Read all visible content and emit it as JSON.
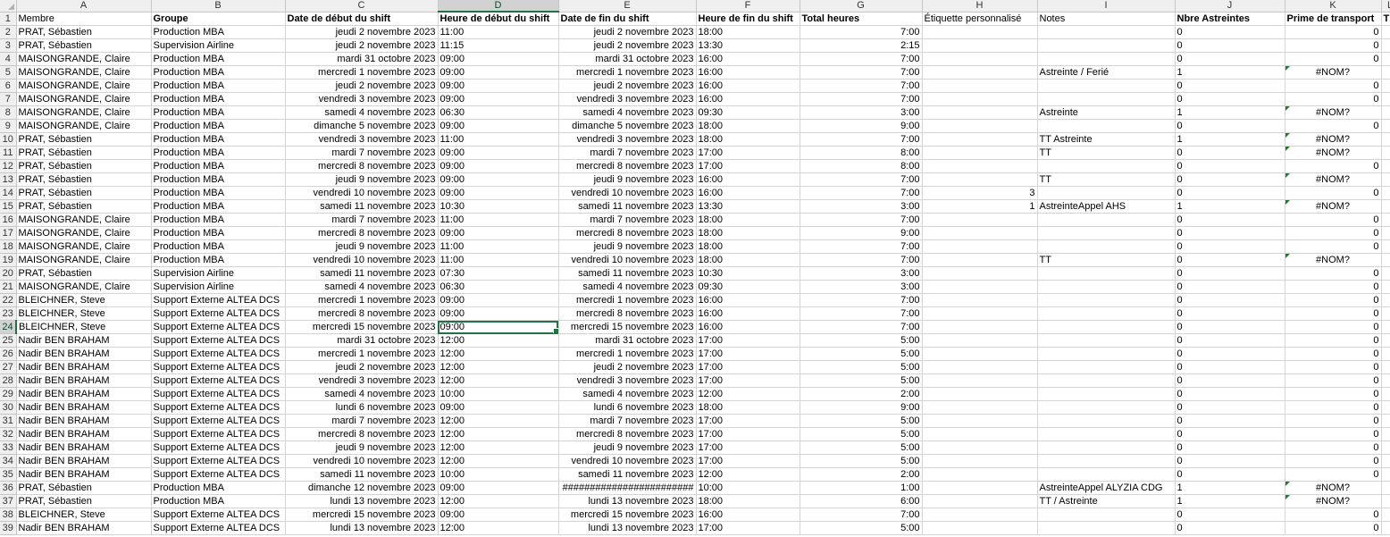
{
  "selected_cell": "D24",
  "columns": [
    "A",
    "B",
    "C",
    "D",
    "E",
    "F",
    "G",
    "H",
    "I",
    "J",
    "K",
    "L"
  ],
  "headers": [
    "Membre",
    "Groupe",
    "Date de début du shift",
    "Heure de début du shift",
    "Date de fin du shift",
    "Heure de fin du shift",
    "Total heures",
    "Étiquette personnalisé",
    "Notes",
    "Nbre Astreintes",
    "Prime de transport",
    "T"
  ],
  "rows": [
    [
      "PRAT, Sébastien",
      "Production MBA",
      "jeudi 2 novembre 2023",
      "11:00",
      "jeudi 2 novembre 2023",
      "18:00",
      "7:00",
      "",
      "",
      "0",
      "0"
    ],
    [
      "PRAT, Sébastien",
      "Supervision Airline",
      "jeudi 2 novembre 2023",
      "11:15",
      "jeudi 2 novembre 2023",
      "13:30",
      "2:15",
      "",
      "",
      "0",
      "0"
    ],
    [
      "MAISONGRANDE, Claire",
      "Production MBA",
      "mardi 31 octobre 2023",
      "09:00",
      "mardi 31 octobre 2023",
      "16:00",
      "7:00",
      "",
      "",
      "0",
      "0"
    ],
    [
      "MAISONGRANDE, Claire",
      "Production MBA",
      "mercredi 1 novembre 2023",
      "09:00",
      "mercredi 1 novembre 2023",
      "16:00",
      "7:00",
      "",
      "Astreinte / Ferié",
      "1",
      "#NOM?"
    ],
    [
      "MAISONGRANDE, Claire",
      "Production MBA",
      "jeudi 2 novembre 2023",
      "09:00",
      "jeudi 2 novembre 2023",
      "16:00",
      "7:00",
      "",
      "",
      "0",
      "0"
    ],
    [
      "MAISONGRANDE, Claire",
      "Production MBA",
      "vendredi 3 novembre 2023",
      "09:00",
      "vendredi 3 novembre 2023",
      "16:00",
      "7:00",
      "",
      "",
      "0",
      "0"
    ],
    [
      "MAISONGRANDE, Claire",
      "Production MBA",
      "samedi 4 novembre 2023",
      "06:30",
      "samedi 4 novembre 2023",
      "09:30",
      "3:00",
      "",
      "Astreinte",
      "1",
      "#NOM?"
    ],
    [
      "MAISONGRANDE, Claire",
      "Production MBA",
      "dimanche 5 novembre 2023",
      "09:00",
      "dimanche 5 novembre 2023",
      "18:00",
      "9:00",
      "",
      "",
      "0",
      "0"
    ],
    [
      "PRAT, Sébastien",
      "Production MBA",
      "vendredi 3 novembre 2023",
      "11:00",
      "vendredi 3 novembre 2023",
      "18:00",
      "7:00",
      "",
      "TT Astreinte",
      "1",
      "#NOM?"
    ],
    [
      "PRAT, Sébastien",
      "Production MBA",
      "mardi 7 novembre 2023",
      "09:00",
      "mardi 7 novembre 2023",
      "17:00",
      "8:00",
      "",
      "TT",
      "0",
      "#NOM?"
    ],
    [
      "PRAT, Sébastien",
      "Production MBA",
      "mercredi 8 novembre 2023",
      "09:00",
      "mercredi 8 novembre 2023",
      "17:00",
      "8:00",
      "",
      "",
      "0",
      "0"
    ],
    [
      "PRAT, Sébastien",
      "Production MBA",
      "jeudi 9 novembre 2023",
      "09:00",
      "jeudi 9 novembre 2023",
      "16:00",
      "7:00",
      "",
      "TT",
      "0",
      "#NOM?"
    ],
    [
      "PRAT, Sébastien",
      "Production MBA",
      "vendredi 10 novembre 2023",
      "09:00",
      "vendredi 10 novembre 2023",
      "16:00",
      "7:00",
      "3",
      "",
      "0",
      "0"
    ],
    [
      "PRAT, Sébastien",
      "Production MBA",
      "samedi 11 novembre 2023",
      "10:30",
      "samedi 11 novembre 2023",
      "13:30",
      "3:00",
      "1",
      "AstreinteAppel AHS",
      "1",
      "#NOM?"
    ],
    [
      "MAISONGRANDE, Claire",
      "Production MBA",
      "mardi 7 novembre 2023",
      "11:00",
      "mardi 7 novembre 2023",
      "18:00",
      "7:00",
      "",
      "",
      "0",
      "0"
    ],
    [
      "MAISONGRANDE, Claire",
      "Production MBA",
      "mercredi 8 novembre 2023",
      "09:00",
      "mercredi 8 novembre 2023",
      "18:00",
      "9:00",
      "",
      "",
      "0",
      "0"
    ],
    [
      "MAISONGRANDE, Claire",
      "Production MBA",
      "jeudi 9 novembre 2023",
      "11:00",
      "jeudi 9 novembre 2023",
      "18:00",
      "7:00",
      "",
      "",
      "0",
      "0"
    ],
    [
      "MAISONGRANDE, Claire",
      "Production MBA",
      "vendredi 10 novembre 2023",
      "11:00",
      "vendredi 10 novembre 2023",
      "18:00",
      "7:00",
      "",
      "TT",
      "0",
      "#NOM?"
    ],
    [
      "PRAT, Sébastien",
      "Supervision Airline",
      "samedi 11 novembre 2023",
      "07:30",
      "samedi 11 novembre 2023",
      "10:30",
      "3:00",
      "",
      "",
      "0",
      "0"
    ],
    [
      "MAISONGRANDE, Claire",
      "Supervision Airline",
      "samedi 4 novembre 2023",
      "06:30",
      "samedi 4 novembre 2023",
      "09:30",
      "3:00",
      "",
      "",
      "0",
      "0"
    ],
    [
      "BLEICHNER, Steve",
      "Support Externe ALTEA DCS",
      "mercredi 1 novembre 2023",
      "09:00",
      "mercredi 1 novembre 2023",
      "16:00",
      "7:00",
      "",
      "",
      "0",
      "0"
    ],
    [
      "BLEICHNER, Steve",
      "Support Externe ALTEA DCS",
      "mercredi 8 novembre 2023",
      "09:00",
      "mercredi 8 novembre 2023",
      "16:00",
      "7:00",
      "",
      "",
      "0",
      "0"
    ],
    [
      "BLEICHNER, Steve",
      "Support Externe ALTEA DCS",
      "mercredi 15 novembre 2023",
      "09:00",
      "mercredi 15 novembre 2023",
      "16:00",
      "7:00",
      "",
      "",
      "0",
      "0"
    ],
    [
      "Nadir BEN BRAHAM",
      "Support Externe ALTEA DCS",
      "mardi 31 octobre 2023",
      "12:00",
      "mardi 31 octobre 2023",
      "17:00",
      "5:00",
      "",
      "",
      "0",
      "0"
    ],
    [
      "Nadir BEN BRAHAM",
      "Support Externe ALTEA DCS",
      "mercredi 1 novembre 2023",
      "12:00",
      "mercredi 1 novembre 2023",
      "17:00",
      "5:00",
      "",
      "",
      "0",
      "0"
    ],
    [
      "Nadir BEN BRAHAM",
      "Support Externe ALTEA DCS",
      "jeudi 2 novembre 2023",
      "12:00",
      "jeudi 2 novembre 2023",
      "17:00",
      "5:00",
      "",
      "",
      "0",
      "0"
    ],
    [
      "Nadir BEN BRAHAM",
      "Support Externe ALTEA DCS",
      "vendredi 3 novembre 2023",
      "12:00",
      "vendredi 3 novembre 2023",
      "17:00",
      "5:00",
      "",
      "",
      "0",
      "0"
    ],
    [
      "Nadir BEN BRAHAM",
      "Support Externe ALTEA DCS",
      "samedi 4 novembre 2023",
      "10:00",
      "samedi 4 novembre 2023",
      "12:00",
      "2:00",
      "",
      "",
      "0",
      "0"
    ],
    [
      "Nadir BEN BRAHAM",
      "Support Externe ALTEA DCS",
      "lundi 6 novembre 2023",
      "09:00",
      "lundi 6 novembre 2023",
      "18:00",
      "9:00",
      "",
      "",
      "0",
      "0"
    ],
    [
      "Nadir BEN BRAHAM",
      "Support Externe ALTEA DCS",
      "mardi 7 novembre 2023",
      "12:00",
      "mardi 7 novembre 2023",
      "17:00",
      "5:00",
      "",
      "",
      "0",
      "0"
    ],
    [
      "Nadir BEN BRAHAM",
      "Support Externe ALTEA DCS",
      "mercredi 8 novembre 2023",
      "12:00",
      "mercredi 8 novembre 2023",
      "17:00",
      "5:00",
      "",
      "",
      "0",
      "0"
    ],
    [
      "Nadir BEN BRAHAM",
      "Support Externe ALTEA DCS",
      "jeudi 9 novembre 2023",
      "12:00",
      "jeudi 9 novembre 2023",
      "17:00",
      "5:00",
      "",
      "",
      "0",
      "0"
    ],
    [
      "Nadir BEN BRAHAM",
      "Support Externe ALTEA DCS",
      "vendredi 10 novembre 2023",
      "12:00",
      "vendredi 10 novembre 2023",
      "17:00",
      "5:00",
      "",
      "",
      "0",
      "0"
    ],
    [
      "Nadir BEN BRAHAM",
      "Support Externe ALTEA DCS",
      "samedi 11 novembre 2023",
      "10:00",
      "samedi 11 novembre 2023",
      "12:00",
      "2:00",
      "",
      "",
      "0",
      "0"
    ],
    [
      "PRAT, Sébastien",
      "Production MBA",
      "dimanche 12 novembre 2023",
      "09:00",
      "########################",
      "10:00",
      "1:00",
      "",
      "AstreinteAppel ALYZIA CDG",
      "1",
      "#NOM?"
    ],
    [
      "PRAT, Sébastien",
      "Production MBA",
      "lundi 13 novembre 2023",
      "12:00",
      "lundi 13 novembre 2023",
      "18:00",
      "6:00",
      "",
      "TT / Astreinte",
      "1",
      "#NOM?"
    ],
    [
      "BLEICHNER, Steve",
      "Support Externe ALTEA DCS",
      "mercredi 15 novembre 2023",
      "09:00",
      "mercredi 15 novembre 2023",
      "16:00",
      "7:00",
      "",
      "",
      "0",
      "0"
    ],
    [
      "Nadir BEN BRAHAM",
      "Support Externe ALTEA DCS",
      "lundi 13 novembre 2023",
      "12:00",
      "lundi 13 novembre 2023",
      "17:00",
      "5:00",
      "",
      "",
      "0",
      "0"
    ]
  ]
}
